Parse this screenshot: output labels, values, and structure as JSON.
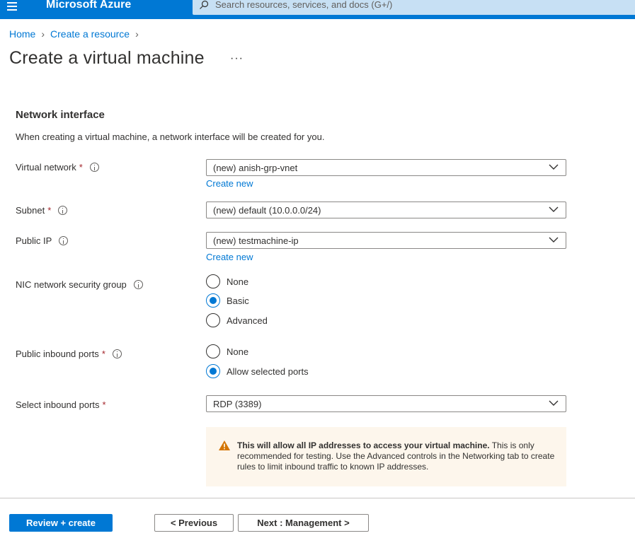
{
  "topbar": {
    "brand": "Microsoft Azure",
    "search_placeholder": "Search resources, services, and docs (G+/)",
    "icons": [
      "hamburger-menu-icon",
      "search-icon"
    ]
  },
  "breadcrumb": {
    "items": [
      "Home",
      "Create a resource"
    ]
  },
  "page": {
    "title": "Create a virtual machine",
    "more": "···"
  },
  "section": {
    "title": "Network interface",
    "description": "When creating a virtual machine, a network interface will be created for you."
  },
  "fields": {
    "virtual_network": {
      "label": "Virtual network",
      "required": "*",
      "value": "(new) anish-grp-vnet",
      "link": "Create new"
    },
    "subnet": {
      "label": "Subnet",
      "required": "*",
      "value": "(new) default (10.0.0.0/24)"
    },
    "public_ip": {
      "label": "Public IP",
      "value": "(new) testmachine-ip",
      "link": "Create new"
    },
    "nic_nsg": {
      "label": "NIC network security group",
      "options": [
        "None",
        "Basic",
        "Advanced"
      ],
      "selected": "Basic"
    },
    "public_inbound_ports": {
      "label": "Public inbound ports",
      "required": "*",
      "options": [
        "None",
        "Allow selected ports"
      ],
      "selected": "Allow selected ports"
    },
    "select_inbound_ports": {
      "label": "Select inbound ports",
      "required": "*",
      "value": "RDP (3389)"
    }
  },
  "warning": {
    "bold": "This will allow all IP addresses to access your virtual machine.",
    "text": " This is only recommended for testing.  Use the Advanced controls in the Networking tab to create rules to limit inbound traffic to known IP addresses.",
    "icon": "warning-triangle-icon"
  },
  "footer": {
    "review_create": "Review + create",
    "previous": "< Previous",
    "next": "Next : Management >"
  },
  "colors": {
    "accent": "#0078d4",
    "required": "#a4262c",
    "warning_bg": "#fdf6ec",
    "warning_icon": "#d47500"
  }
}
